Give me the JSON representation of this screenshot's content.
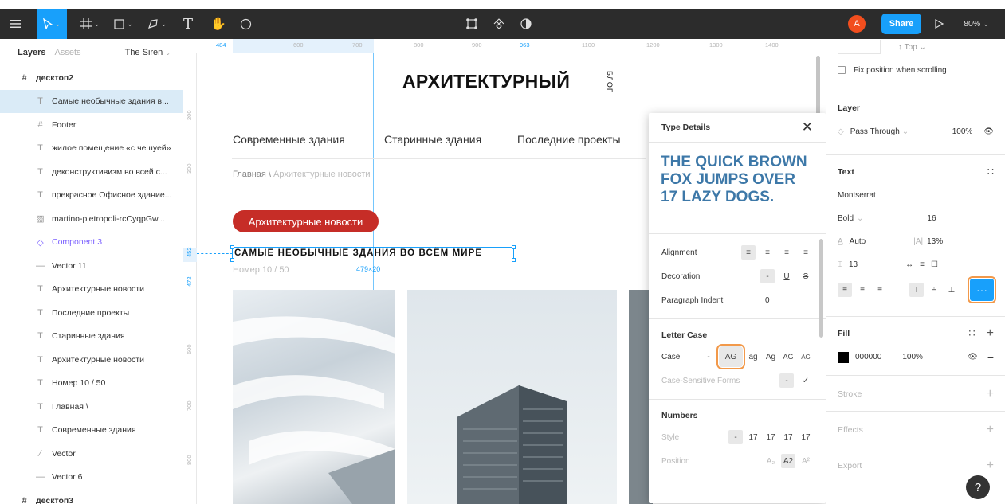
{
  "toolbar": {
    "zoom": "80%",
    "share_label": "Share",
    "avatar_letter": "A",
    "colors": {
      "bg": "#2c2c2c",
      "accent": "#18a0fb",
      "avatar": "#f24e1e"
    }
  },
  "layers_panel": {
    "tab_layers": "Layers",
    "tab_assets": "Assets",
    "page_name": "The Siren",
    "items": [
      {
        "icon": "frame-icon",
        "label": "десктоп2"
      },
      {
        "icon": "text-icon",
        "label": "Самые необычные здания в..."
      },
      {
        "icon": "frame-icon",
        "label": "Footer"
      },
      {
        "icon": "text-icon",
        "label": "жилое помещение «с чешуей»"
      },
      {
        "icon": "text-icon",
        "label": "деконструктивизм во всей с..."
      },
      {
        "icon": "text-icon",
        "label": "прекрасное Офисное здание..."
      },
      {
        "icon": "image-icon",
        "label": "martino-pietropoli-rcCyqpGw..."
      },
      {
        "icon": "component-icon",
        "label": "Component 3"
      },
      {
        "icon": "line-icon",
        "label": "Vector 11"
      },
      {
        "icon": "text-icon",
        "label": "Архитектурные новости"
      },
      {
        "icon": "text-icon",
        "label": "Последние проекты"
      },
      {
        "icon": "text-icon",
        "label": "Старинные здания"
      },
      {
        "icon": "text-icon",
        "label": "Архитектурные новости"
      },
      {
        "icon": "text-icon",
        "label": "Номер 10 / 50"
      },
      {
        "icon": "text-icon",
        "label": "Главная \\"
      },
      {
        "icon": "text-icon",
        "label": "Современные здания"
      },
      {
        "icon": "vector-icon",
        "label": "Vector"
      },
      {
        "icon": "line-icon",
        "label": "Vector 6"
      },
      {
        "icon": "frame-icon",
        "label": "десктоп3"
      }
    ]
  },
  "rulers": {
    "top": [
      "484",
      "600",
      "700",
      "800",
      "900",
      "963",
      "1100",
      "1200",
      "1300",
      "1400"
    ],
    "left": [
      "200",
      "300",
      "452",
      "472",
      "600",
      "700",
      "800"
    ]
  },
  "canvas": {
    "site_title": "АРХИТЕКТУРНЫЙ",
    "site_subtitle": "БЛОГ",
    "nav": [
      "Современные здания",
      "Старинные здания",
      "Последние проекты"
    ],
    "breadcrumb_home": "Главная \\",
    "breadcrumb_current": " Архитектурные новости",
    "pill_label": "Архитектурные новости",
    "pill_color": "#c62d27",
    "selected_heading": "САМЫЕ НЕОБЫЧНЫЕ ЗДАНИЯ ВО ВСЁМ МИРЕ",
    "counter": "Номер 10 / 50",
    "selection_size": "479×20"
  },
  "type_details": {
    "title": "Type Details",
    "preview": "THE QUICK BROWN FOX JUMPS OVER 17 LAZY DOGS.",
    "alignment_label": "Alignment",
    "decoration_label": "Decoration",
    "paragraph_indent_label": "Paragraph Indent",
    "paragraph_indent_value": "0",
    "letter_case_title": "Letter Case",
    "case_label": "Case",
    "case_options": [
      "-",
      "AG",
      "ag",
      "Ag",
      "AG",
      "AG"
    ],
    "case_sensitive_label": "Case-Sensitive Forms",
    "numbers_title": "Numbers",
    "style_label": "Style",
    "style_options": [
      "-",
      "17",
      "17",
      "17",
      "17"
    ],
    "position_label": "Position",
    "position_options": [
      "A₂",
      "A2",
      "A²"
    ]
  },
  "right_panel": {
    "top_constraint": "Top",
    "fix_position": "Fix position when scrolling",
    "layer_title": "Layer",
    "blend_mode": "Pass Through",
    "layer_opacity": "100%",
    "text_title": "Text",
    "font_family": "Montserrat",
    "font_weight": "Bold",
    "font_size": "16",
    "line_height": "Auto",
    "letter_spacing": "13%",
    "paragraph_spacing": "13",
    "fill_title": "Fill",
    "fill_hex": "000000",
    "fill_opacity": "100%",
    "fill_color": "#000000",
    "stroke_title": "Stroke",
    "effects_title": "Effects",
    "export_title": "Export"
  }
}
